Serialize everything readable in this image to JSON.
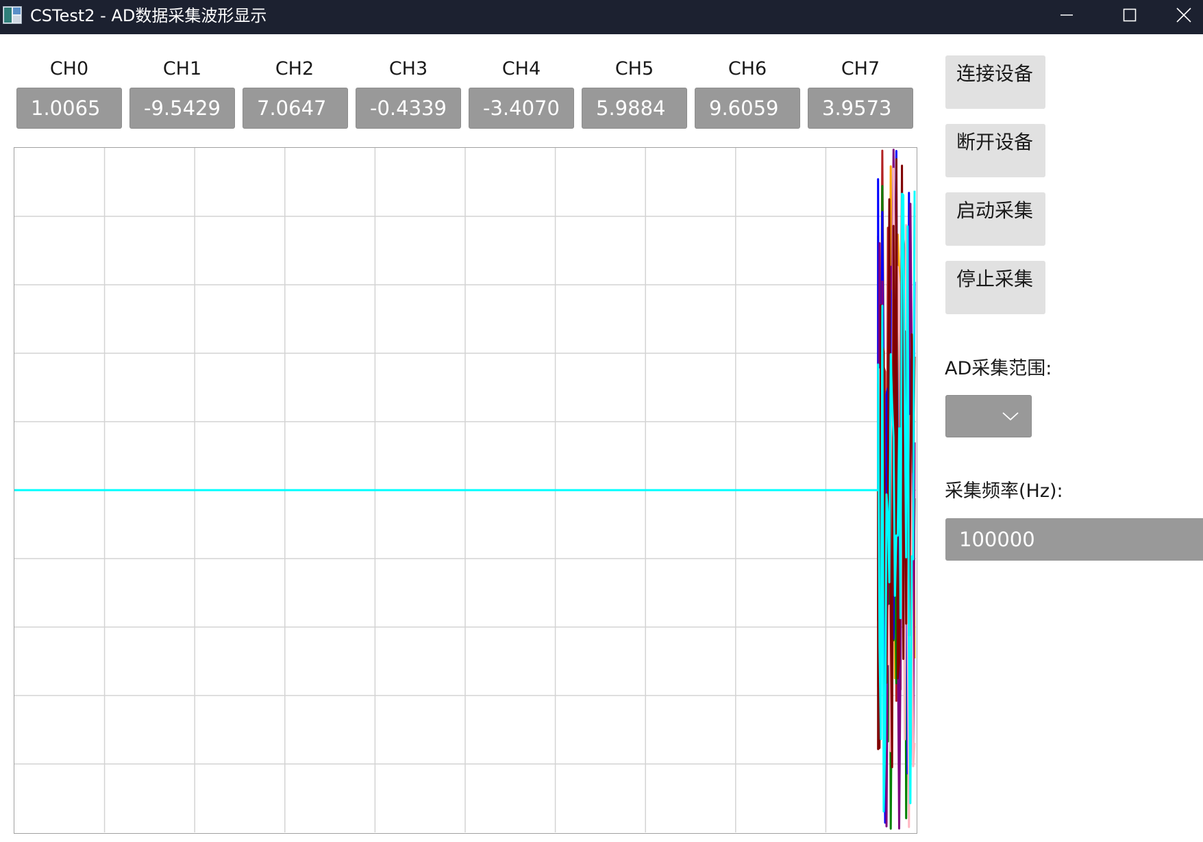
{
  "window": {
    "title": "CSTest2 - AD数据采集波形显示",
    "controls": {
      "minimize": "minimize-icon",
      "maximize": "maximize-icon",
      "close": "close-icon"
    }
  },
  "channels": [
    {
      "label": "CH0",
      "value": "1.0065"
    },
    {
      "label": "CH1",
      "value": "-9.5429"
    },
    {
      "label": "CH2",
      "value": "7.0647"
    },
    {
      "label": "CH3",
      "value": "-0.4339"
    },
    {
      "label": "CH4",
      "value": "-3.4070"
    },
    {
      "label": "CH5",
      "value": "5.9884"
    },
    {
      "label": "CH6",
      "value": "9.6059"
    },
    {
      "label": "CH7",
      "value": "3.9573"
    }
  ],
  "buttons": {
    "connect": "连接设备",
    "disconnect": "断开设备",
    "start": "启动采集",
    "stop": "停止采集"
  },
  "ad_range": {
    "label": "AD采集范围:",
    "selected": ""
  },
  "sample_rate": {
    "label": "采集频率(Hz):",
    "value": "100000"
  },
  "colors": {
    "titlebar": "#1c2130",
    "value_box": "#999999",
    "button": "#e1e1e1",
    "grid": "#d3d3d3",
    "series": [
      "#b22222",
      "#ffa500",
      "#008000",
      "#0000ff",
      "#800080",
      "#ffb6c1",
      "#800000",
      "#00ffff"
    ]
  },
  "chart_data": {
    "type": "line",
    "grid": true,
    "x_divisions": 10,
    "y_divisions": 10,
    "ylim": [
      -10,
      10
    ],
    "note_series": "8 channels; flat at 0 until the final ~4% of the window, then dense noise across the full range",
    "flat_fraction": 0.958
  }
}
